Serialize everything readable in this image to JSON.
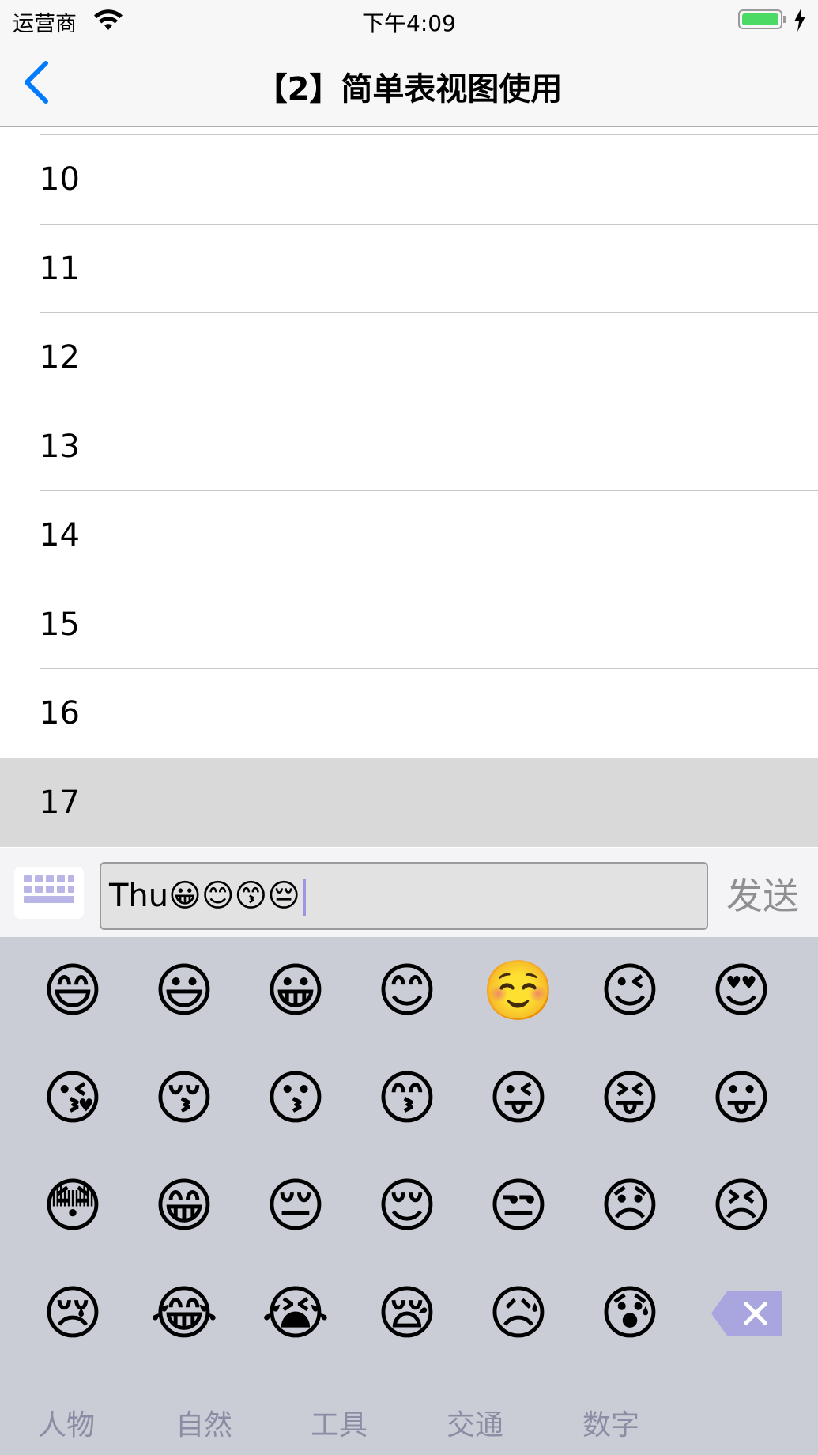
{
  "status_bar": {
    "carrier": "运营商",
    "time": "下午4:09",
    "battery_level": 1.0
  },
  "nav": {
    "title": "【2】简单表视图使用",
    "back_icon": "chevron-left-icon"
  },
  "table": {
    "rows": [
      "10",
      "11",
      "12",
      "13",
      "14",
      "15",
      "16",
      "17"
    ],
    "selected_row": "17"
  },
  "input_bar": {
    "text_value": "Thu😀😊😙😔",
    "send_label": "发送",
    "keyboard_toggle_icon": "keyboard-icon"
  },
  "emoji_keyboard": {
    "rows": [
      [
        "😄",
        "😃",
        "😀",
        "😊",
        "☺️",
        "😉",
        "😍"
      ],
      [
        "😘",
        "😚",
        "😗",
        "😙",
        "😜",
        "😝",
        "😛"
      ],
      [
        "😳",
        "😁",
        "😔",
        "😌",
        "😒",
        "😞",
        "😣"
      ],
      [
        "😢",
        "😂",
        "😭",
        "😪",
        "😥",
        "😰"
      ]
    ],
    "delete_icon": "backspace-icon",
    "tabs": [
      "人物",
      "自然",
      "工具",
      "交通",
      "数字"
    ]
  },
  "colors": {
    "accent": "#007aff",
    "battery": "#4cd964",
    "keyboard_bg": "#cacdd6",
    "delete_key": "#a9a6df",
    "tab_text": "#8c8ca4"
  }
}
